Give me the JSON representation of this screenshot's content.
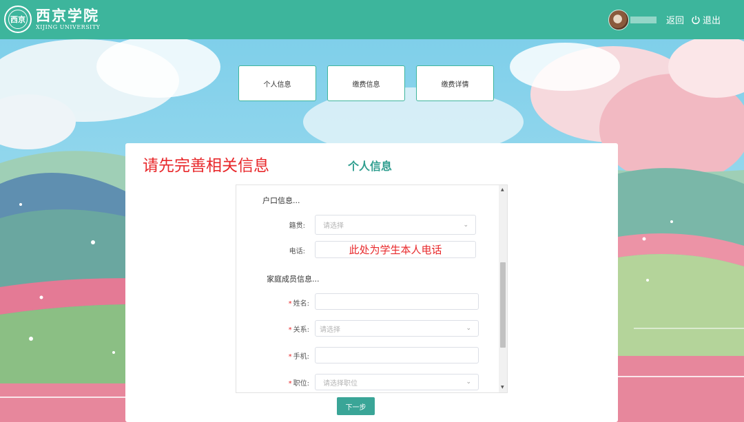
{
  "header": {
    "logo_seal_text": "西京",
    "logo_cn": "西京学院",
    "logo_en": "XIJING UNIVERSITY",
    "back_label": "返回",
    "logout_label": "退出",
    "accent_color": "#3db59c"
  },
  "tabs": [
    {
      "label": "个人信息"
    },
    {
      "label": "缴费信息"
    },
    {
      "label": "缴费详情"
    }
  ],
  "card": {
    "notice": "请先完善相关信息",
    "section_title": "个人信息"
  },
  "form": {
    "household_group": "户口信息...",
    "native_place": {
      "label": "籍贯:",
      "placeholder": "请选择"
    },
    "phone": {
      "label": "电话:",
      "hint": "此处为学生本人电话"
    },
    "family_group": "家庭成员信息...",
    "member_name": {
      "required": "*",
      "label": "姓名:",
      "value": ""
    },
    "relation": {
      "required": "*",
      "label": "关系:",
      "placeholder": "请选择"
    },
    "mobile": {
      "required": "*",
      "label": "手机:",
      "value": ""
    },
    "position": {
      "required": "*",
      "label": "职位:",
      "placeholder": "请选择职位"
    }
  },
  "next_button": "下一步"
}
